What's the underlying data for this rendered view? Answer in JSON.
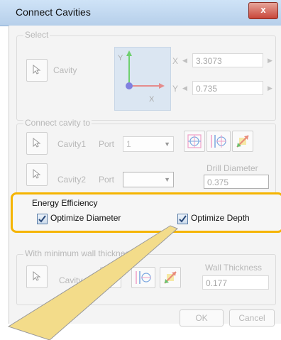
{
  "window": {
    "title": "Connect Cavities",
    "close_label": "x"
  },
  "select": {
    "group_label": "Select",
    "cavity_label": "Cavity",
    "axes": {
      "x": "X",
      "y": "Y"
    },
    "x_label": "X",
    "x_value": "3.3073",
    "y_label": "Y",
    "y_value": "0.735"
  },
  "connect": {
    "group_label": "Connect cavity to",
    "cavity1_label": "Cavity1",
    "port1_label": "Port",
    "port1_value": "1",
    "cavity2_label": "Cavity2",
    "port2_label": "Port",
    "port2_value": "",
    "drill_label": "Drill Diameter",
    "drill_value": "0.375"
  },
  "energy": {
    "group_label": "Energy Efficiency",
    "opt_diameter_label": "Optimize Diameter",
    "opt_diameter_checked": true,
    "opt_depth_label": "Optimize Depth",
    "opt_depth_checked": true
  },
  "wall": {
    "group_label": "With minimum wall thickness",
    "cavity_label": "Cavity",
    "thickness_label": "Wall Thickness",
    "thickness_value": "0.177"
  },
  "buttons": {
    "ok": "OK",
    "cancel": "Cancel"
  },
  "colors": {
    "highlight": "#f5b400",
    "callout": "#f3dc8a"
  }
}
